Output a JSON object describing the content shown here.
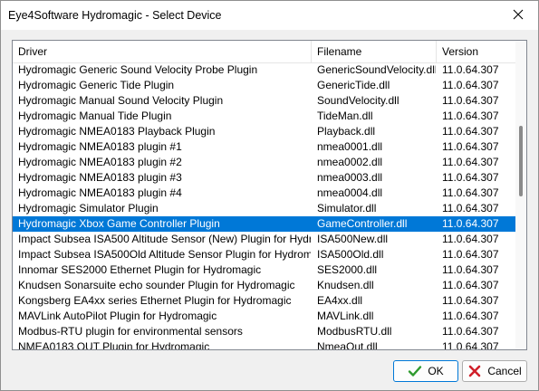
{
  "window": {
    "title": "Eye4Software Hydromagic - Select Device"
  },
  "listview": {
    "columns": [
      "Driver",
      "Filename",
      "Version"
    ],
    "rows": [
      {
        "driver": "Hydromagic Generic Sound Velocity Probe Plugin",
        "file": "GenericSoundVelocity.dll",
        "version": "11.0.64.307"
      },
      {
        "driver": "Hydromagic Generic Tide Plugin",
        "file": "GenericTide.dll",
        "version": "11.0.64.307"
      },
      {
        "driver": "Hydromagic Manual Sound Velocity Plugin",
        "file": "SoundVelocity.dll",
        "version": "11.0.64.307"
      },
      {
        "driver": "Hydromagic Manual Tide Plugin",
        "file": "TideMan.dll",
        "version": "11.0.64.307"
      },
      {
        "driver": "Hydromagic NMEA0183 Playback Plugin",
        "file": "Playback.dll",
        "version": "11.0.64.307"
      },
      {
        "driver": "Hydromagic NMEA0183 plugin #1",
        "file": "nmea0001.dll",
        "version": "11.0.64.307"
      },
      {
        "driver": "Hydromagic NMEA0183 plugin #2",
        "file": "nmea0002.dll",
        "version": "11.0.64.307"
      },
      {
        "driver": "Hydromagic NMEA0183 plugin #3",
        "file": "nmea0003.dll",
        "version": "11.0.64.307"
      },
      {
        "driver": "Hydromagic NMEA0183 plugin #4",
        "file": "nmea0004.dll",
        "version": "11.0.64.307"
      },
      {
        "driver": "Hydromagic Simulator Plugin",
        "file": "Simulator.dll",
        "version": "11.0.64.307"
      },
      {
        "driver": "Hydromagic Xbox Game Controller Plugin",
        "file": "GameController.dll",
        "version": "11.0.64.307",
        "selected": true
      },
      {
        "driver": "Impact Subsea ISA500 Altitude Sensor (New) Plugin for Hydrom...",
        "file": "ISA500New.dll",
        "version": "11.0.64.307"
      },
      {
        "driver": "Impact Subsea ISA500Old Altitude Sensor Plugin for Hydromagic",
        "file": "ISA500Old.dll",
        "version": "11.0.64.307"
      },
      {
        "driver": "Innomar SES2000 Ethernet Plugin for Hydromagic",
        "file": "SES2000.dll",
        "version": "11.0.64.307"
      },
      {
        "driver": "Knudsen Sonarsuite echo sounder Plugin for Hydromagic",
        "file": "Knudsen.dll",
        "version": "11.0.64.307"
      },
      {
        "driver": "Kongsberg EA4xx series Ethernet Plugin for Hydromagic",
        "file": "EA4xx.dll",
        "version": "11.0.64.307"
      },
      {
        "driver": "MAVLink AutoPilot Plugin for Hydromagic",
        "file": "MAVLink.dll",
        "version": "11.0.64.307"
      },
      {
        "driver": "Modbus-RTU plugin for environmental sensors",
        "file": "ModbusRTU.dll",
        "version": "11.0.64.307"
      },
      {
        "driver": "NMEA0183 OUT Plugin for Hydromagic",
        "file": "NmeaOut.dll",
        "version": "11.0.64.307"
      }
    ]
  },
  "buttons": {
    "ok": {
      "label": "OK",
      "icon": "check-icon"
    },
    "cancel": {
      "label": "Cancel",
      "icon": "x-icon"
    }
  },
  "colors": {
    "selection": "#0078d7",
    "ok_check": "#2e9a2e",
    "cancel_x": "#d0202a"
  }
}
